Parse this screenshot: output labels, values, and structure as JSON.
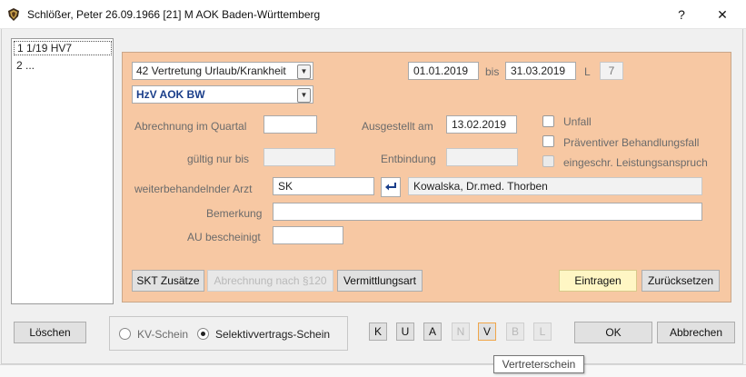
{
  "window": {
    "title": "Schlößer, Peter 26.09.1966  [21]  M AOK Baden-Württemberg",
    "help_label": "?",
    "close_label": "✕"
  },
  "list": {
    "items": [
      {
        "label": "1  1/19 HV7",
        "selected": true
      },
      {
        "label": "2  ..."
      }
    ]
  },
  "form": {
    "case_type": "42 Vertretung Urlaub/Krankheit",
    "contract": "HzV AOK BW",
    "date_from": "01.01.2019",
    "bis_label": "bis",
    "date_to": "31.03.2019",
    "l_label": "L",
    "l_value": "7",
    "abrechnung_label": "Abrechnung im Quartal",
    "abrechnung_value": "",
    "ausgestellt_label": "Ausgestellt am",
    "ausgestellt_value": "13.02.2019",
    "gueltig_label": "gültig nur bis",
    "gueltig_value": "",
    "entbindung_label": "Entbindung",
    "entbindung_value": "",
    "unfall_label": "Unfall",
    "praeventiv_label": "Präventiver Behandlungsfall",
    "leistung_label": "eingeschr. Leistungsanspruch",
    "arzt_label": "weiterbehandelnder Arzt",
    "arzt_code": "SK",
    "arzt_name": "Kowalska, Dr.med. Thorben",
    "bemerkung_label": "Bemerkung",
    "bemerkung_value": "",
    "au_label": "AU bescheinigt",
    "au_value": ""
  },
  "panel_buttons": {
    "skt": "SKT Zusätze",
    "abrechnung120": "Abrechnung nach §120",
    "vermittlung": "Vermittlungsart",
    "eintragen": "Eintragen",
    "zuruecksetzen": "Zurücksetzen"
  },
  "bottom": {
    "loeschen": "Löschen",
    "kv_schein": "KV-Schein",
    "selektiv_schein": "Selektivvertrags-Schein",
    "letters": [
      "K",
      "U",
      "A",
      "N",
      "V",
      "B",
      "L"
    ],
    "ok": "OK",
    "abbrechen": "Abbrechen",
    "tooltip": "Vertreterschein"
  }
}
